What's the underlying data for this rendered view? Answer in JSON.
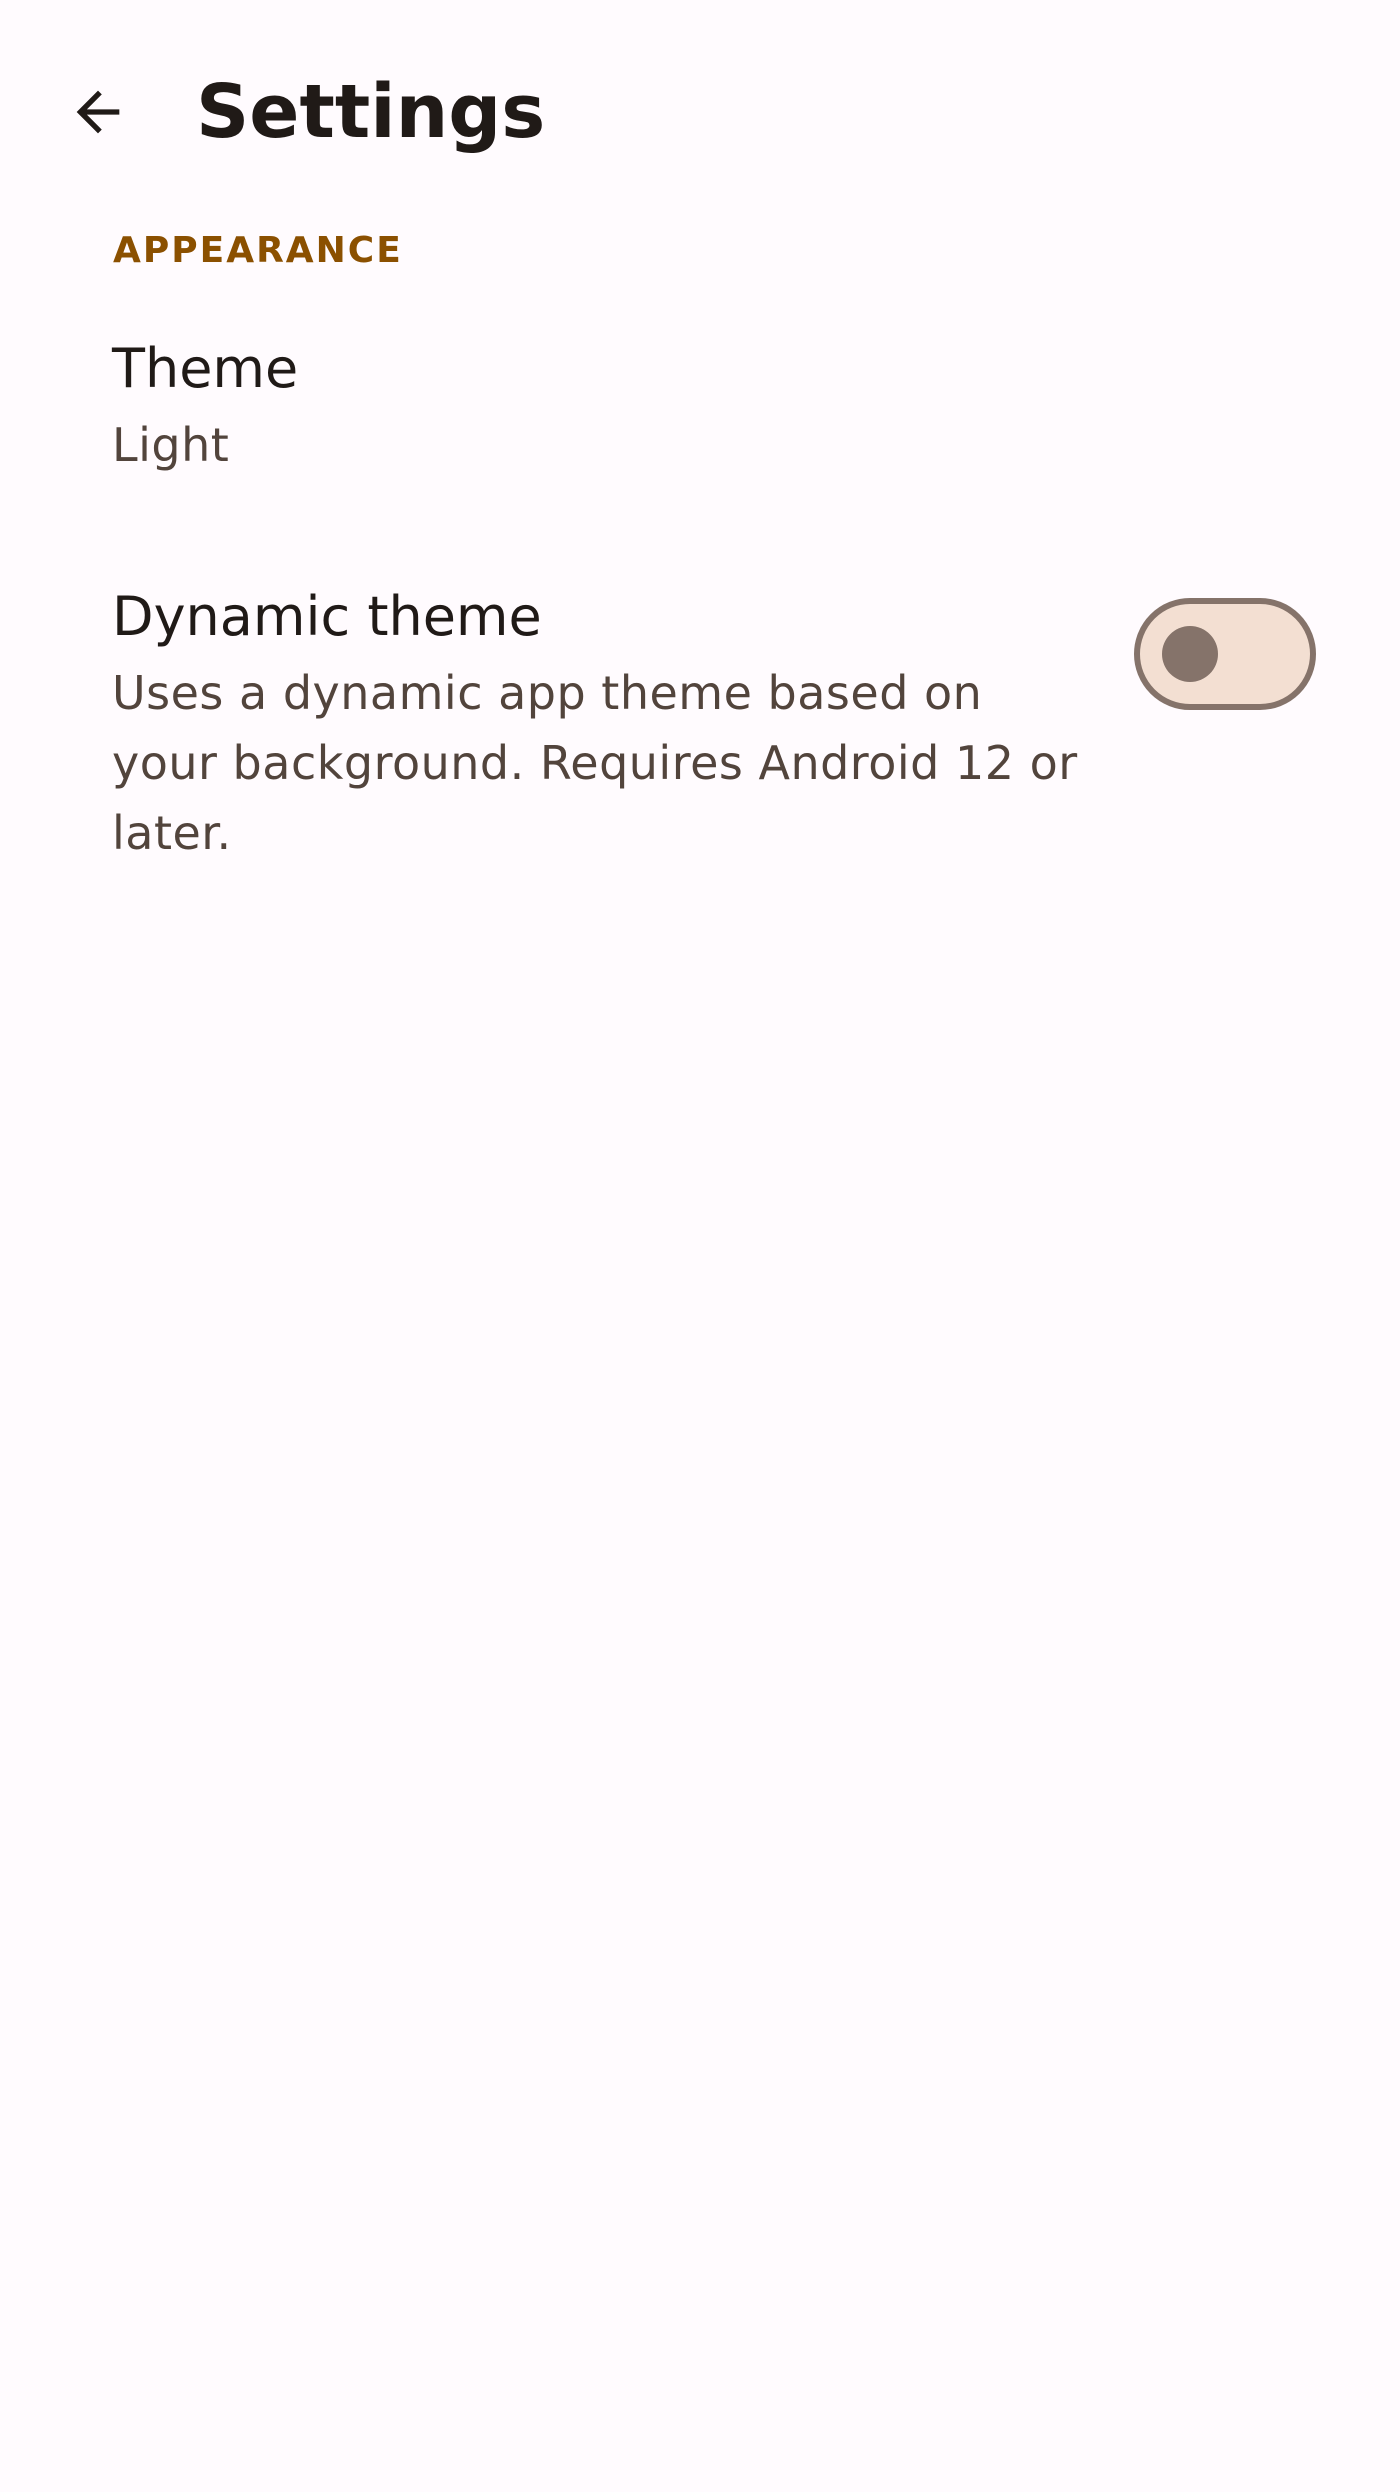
{
  "header": {
    "title": "Settings",
    "back_icon": "arrow-back-icon"
  },
  "sections": {
    "appearance": {
      "label": "APPEARANCE",
      "theme": {
        "title": "Theme",
        "summary": "Light"
      },
      "dynamic_theme": {
        "title": "Dynamic theme",
        "summary": "Uses a dynamic app theme based on your background. Requires Android 12 or later.",
        "enabled": false
      }
    }
  },
  "colors": {
    "background": "#FFFBFE",
    "accent": "#8B5000",
    "on_surface": "#201A17",
    "on_surface_variant": "#52443C",
    "outline": "#85736A",
    "switch_track": "#F3DFD2"
  }
}
